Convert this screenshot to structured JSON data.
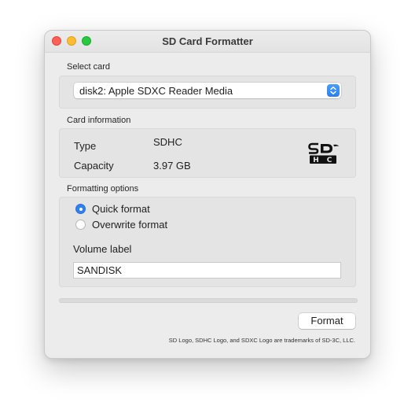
{
  "window": {
    "title": "SD Card Formatter"
  },
  "select_card": {
    "label": "Select card",
    "value": "disk2: Apple SDXC Reader Media"
  },
  "card_info": {
    "label": "Card information",
    "type_label": "Type",
    "type_value": "SDHC",
    "capacity_label": "Capacity",
    "capacity_value": "3.97 GB",
    "logo_icon": "sdhc-logo-icon"
  },
  "formatting": {
    "label": "Formatting options",
    "quick_label": "Quick format",
    "overwrite_label": "Overwrite format",
    "selected": "quick",
    "volume_label_caption": "Volume label",
    "volume_label_value": "SANDISK"
  },
  "progress": {
    "fraction": 0
  },
  "actions": {
    "format_label": "Format"
  },
  "footer": {
    "trademark_text": "SD Logo, SDHC Logo, and SDXC Logo are trademarks of SD-3C, LLC."
  },
  "colors": {
    "accent": "#2f7ff0",
    "close": "#fe5f57",
    "minimize": "#febc2e",
    "zoom": "#28c840"
  }
}
